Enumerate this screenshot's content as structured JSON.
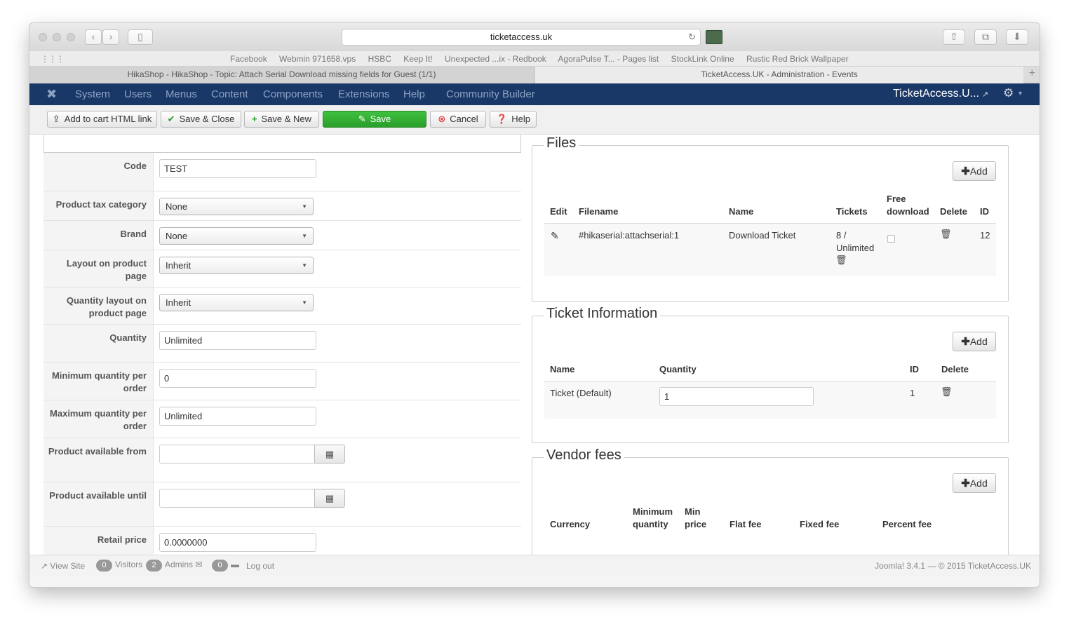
{
  "browser": {
    "url": "ticketaccess.uk",
    "bookmarks": [
      "Facebook",
      "Webmin 971658.vps",
      "HSBC",
      "Keep It!",
      "Unexpected ...ix - Redbook",
      "AgoraPulse T... - Pages list",
      "StockLink Online",
      "Rustic Red Brick Wallpaper"
    ],
    "tabs": [
      {
        "label": "HikaShop - HikaShop - Topic: Attach Serial Download missing fields for Guest (1/1)"
      },
      {
        "label": "TicketAccess.UK - Administration - Events"
      }
    ]
  },
  "nav": {
    "items": [
      "System",
      "Users",
      "Menus",
      "Content",
      "Components",
      "Extensions",
      "Help",
      "Community Builder"
    ],
    "site_name": "TicketAccess.U..."
  },
  "toolbar": {
    "add_to_cart_label": "Add to cart HTML link",
    "save_close_label": "Save & Close",
    "save_new_label": "Save & New",
    "save_label": "Save",
    "cancel_label": "Cancel",
    "help_label": "Help"
  },
  "form": {
    "code_label": "Code",
    "code_value": "TEST",
    "tax_label": "Product tax category",
    "tax_value": "None",
    "brand_label": "Brand",
    "brand_value": "None",
    "layout_label": "Layout on product page",
    "layout_value": "Inherit",
    "qty_layout_label": "Quantity layout on product page",
    "qty_layout_value": "Inherit",
    "quantity_label": "Quantity",
    "quantity_value": "Unlimited",
    "min_qty_label": "Minimum quantity per order",
    "min_qty_value": "0",
    "max_qty_label": "Maximum quantity per order",
    "max_qty_value": "Unlimited",
    "avail_from_label": "Product available from",
    "avail_until_label": "Product available until",
    "retail_label": "Retail price",
    "retail_value": "0.0000000"
  },
  "files": {
    "legend": "Files",
    "add_label": "Add",
    "headers": {
      "edit": "Edit",
      "filename": "Filename",
      "name": "Name",
      "tickets": "Tickets",
      "free_download": "Free download",
      "delete": "Delete",
      "id": "ID"
    },
    "row": {
      "filename": "#hikaserial:attachserial:1",
      "name": "Download Ticket",
      "tickets": "8 / Unlimited",
      "id": "12"
    }
  },
  "ticket_info": {
    "legend": "Ticket Information",
    "add_label": "Add",
    "headers": {
      "name": "Name",
      "quantity": "Quantity",
      "id": "ID",
      "delete": "Delete"
    },
    "row": {
      "name": "Ticket (Default)",
      "quantity": "1",
      "id": "1"
    }
  },
  "vendor_fees": {
    "legend": "Vendor fees",
    "add_label": "Add",
    "headers": {
      "currency": "Currency",
      "min_quantity": "Minimum quantity",
      "min_price": "Min price",
      "flat_fee": "Flat fee",
      "fixed_fee": "Fixed fee",
      "percent_fee": "Percent fee"
    }
  },
  "status": {
    "view_site": "View Site",
    "visitors_count": "0",
    "visitors_label": "Visitors",
    "admins_count": "2",
    "admins_label": "Admins",
    "messages_count": "0",
    "logout": "Log out",
    "version": "Joomla! 3.4.1  —  © 2015 TicketAccess.UK"
  }
}
